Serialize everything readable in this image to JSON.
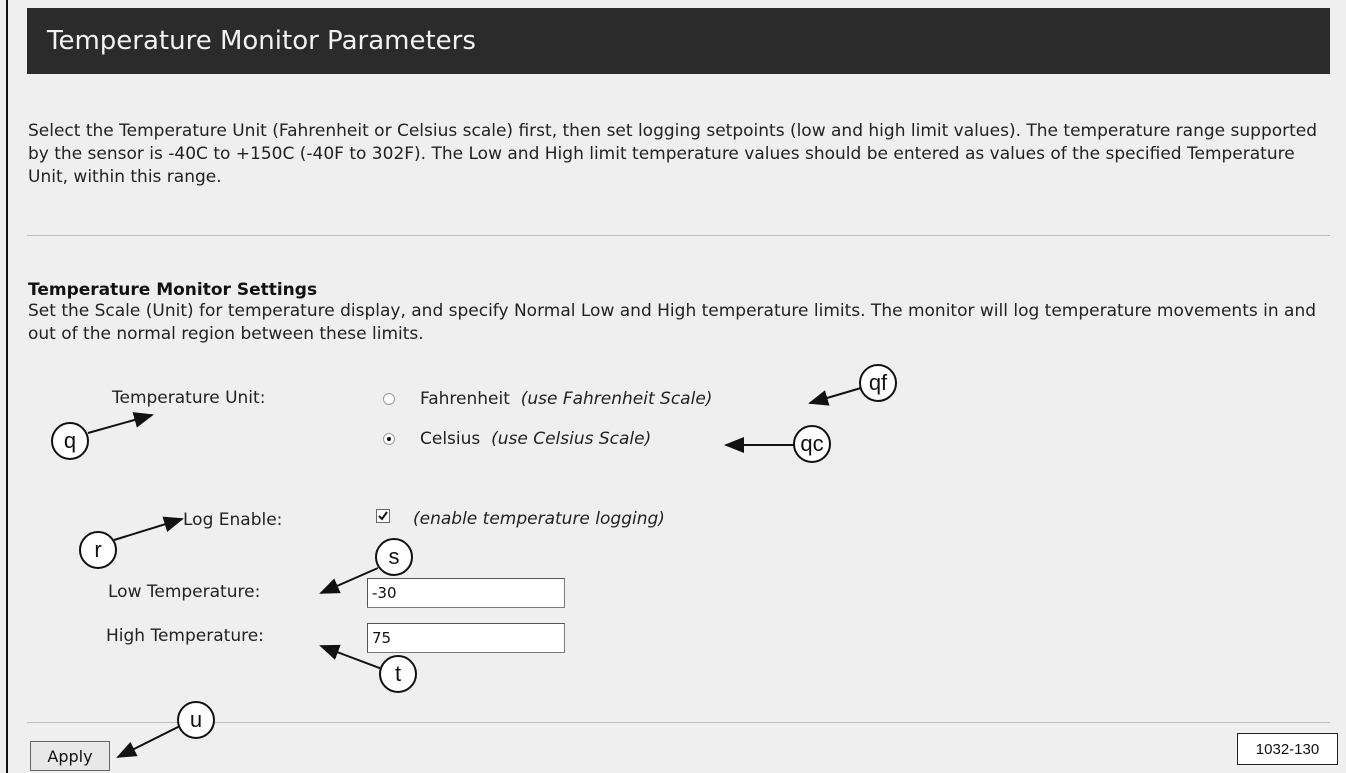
{
  "header": {
    "title": "Temperature Monitor Parameters"
  },
  "intro": {
    "text": "Select the Temperature Unit (Fahrenheit or Celsius scale) first, then set logging setpoints (low and high limit values). The temperature range supported by the sensor is -40C to +150C (-40F to 302F). The Low and High limit temperature values should be entered as values of the specified Temperature Unit, within this range."
  },
  "settings": {
    "heading": "Temperature Monitor Settings",
    "description": "Set the Scale (Unit) for temperature display, and specify Normal Low and High temperature limits. The monitor will log temperature movements in and out of the normal region between these limits.",
    "unit_label": "Temperature Unit:",
    "unit_options": [
      {
        "label": "Fahrenheit",
        "note": "(use Fahrenheit Scale)",
        "selected": false
      },
      {
        "label": "Celsius",
        "note": "(use Celsius Scale)",
        "selected": true
      }
    ],
    "log_label": "Log Enable:",
    "log_checked": true,
    "log_note": "(enable temperature logging)",
    "low_label": "Low Temperature:",
    "low_value": "-30",
    "high_label": "High Temperature:",
    "high_value": "75"
  },
  "footer": {
    "apply_label": "Apply",
    "figure_id": "1032-130"
  },
  "callouts": {
    "q": "q",
    "qf": "qf",
    "qc": "qc",
    "r": "r",
    "s": "s",
    "t": "t",
    "u": "u"
  }
}
